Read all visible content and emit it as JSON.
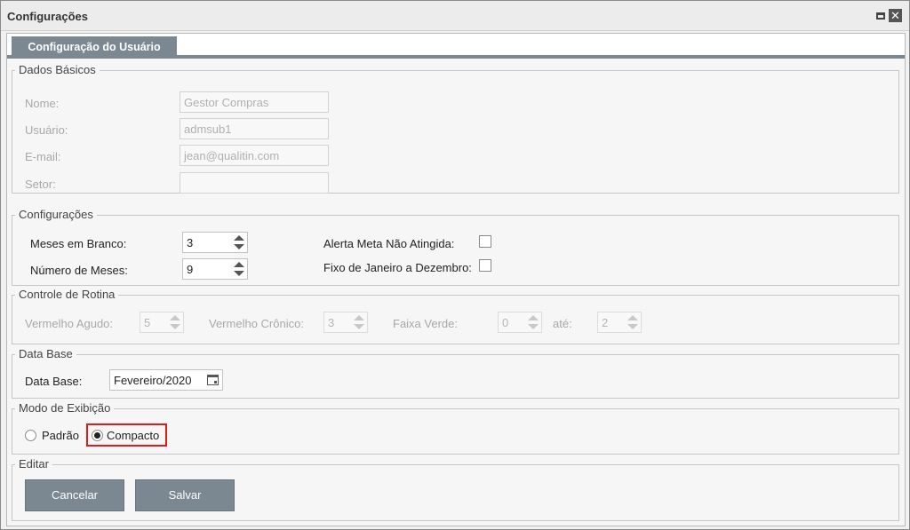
{
  "window": {
    "title": "Configurações"
  },
  "tabs": [
    {
      "label": "Configuração do Usuário"
    }
  ],
  "dados_basicos": {
    "legend": "Dados Básicos",
    "nome": {
      "label": "Nome:",
      "value": "Gestor Compras"
    },
    "usuario": {
      "label": "Usuário:",
      "value": "admsub1"
    },
    "email": {
      "label": "E-mail:",
      "value": "jean@qualitin.com"
    },
    "setor": {
      "label": "Setor:",
      "value": ""
    }
  },
  "configuracoes": {
    "legend": "Configurações",
    "meses_em_branco": {
      "label": "Meses em Branco:",
      "value": "3"
    },
    "numero_de_meses": {
      "label": "Número de Meses:",
      "value": "9"
    },
    "alerta_meta": {
      "label": "Alerta Meta Não Atingida:",
      "checked": false
    },
    "fixo_janeiro": {
      "label": "Fixo de Janeiro a Dezembro:",
      "checked": false
    }
  },
  "controle_rotina": {
    "legend": "Controle de Rotina",
    "vermelho_agudo": {
      "label": "Vermelho Agudo:",
      "value": "5"
    },
    "vermelho_cronico": {
      "label": "Vermelho Crônico:",
      "value": "3"
    },
    "faixa_verde": {
      "label": "Faixa Verde:",
      "value": "0"
    },
    "ate": {
      "label": "até:",
      "value": "2"
    }
  },
  "data_base": {
    "legend": "Data Base",
    "label": "Data Base:",
    "value": "Fevereiro/2020"
  },
  "modo_exibicao": {
    "legend": "Modo de Exibição",
    "options": [
      {
        "label": "Padrão",
        "selected": false
      },
      {
        "label": "Compacto",
        "selected": true
      }
    ],
    "highlight_color": "#e11b1b"
  },
  "editar": {
    "legend": "Editar",
    "cancel_label": "Cancelar",
    "save_label": "Salvar"
  },
  "colors": {
    "accent": "#7b8791"
  }
}
